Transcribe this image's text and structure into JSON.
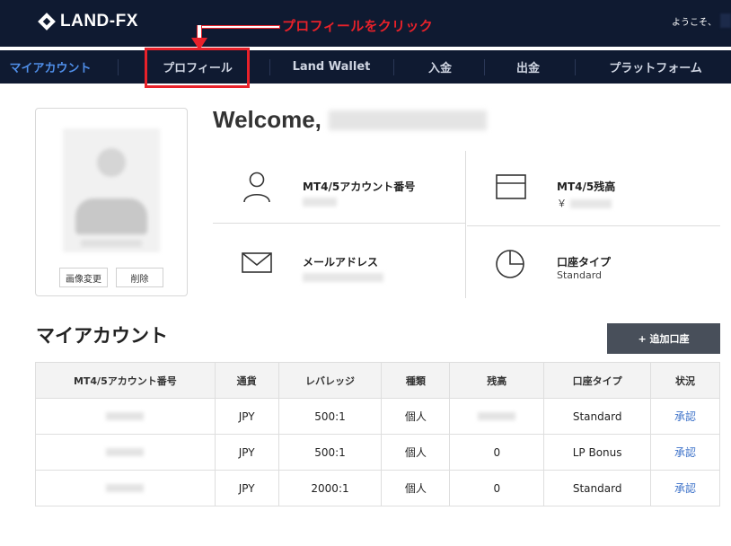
{
  "header": {
    "logo_text": "LAND-FX",
    "greeting": "ようこそ、"
  },
  "annotation": {
    "text": "プロフィールをクリック",
    "color": "#e8212a"
  },
  "nav": {
    "items": [
      {
        "label": "マイアカウント",
        "active": true
      },
      {
        "label": "プロフィール",
        "active": false
      },
      {
        "label": "Land Wallet",
        "active": false
      },
      {
        "label": "入金",
        "active": false
      },
      {
        "label": "出金",
        "active": false
      },
      {
        "label": "プラットフォーム",
        "active": false
      }
    ]
  },
  "profile_card": {
    "change_image_label": "画像変更",
    "delete_label": "削除"
  },
  "welcome": {
    "text": "Welcome,"
  },
  "info": {
    "account_number_label": "MT4/5アカウント番号",
    "balance_label": "MT4/5残高",
    "balance_currency": "￥",
    "email_label": "メールアドレス",
    "account_type_label": "口座タイプ",
    "account_type_value": "Standard"
  },
  "my_account": {
    "title": "マイアカウント",
    "add_button": "+ 追加口座",
    "columns": [
      "MT4/5アカウント番号",
      "通貨",
      "レバレッジ",
      "種類",
      "残高",
      "口座タイプ",
      "状況"
    ],
    "rows": [
      {
        "currency": "JPY",
        "leverage": "500:1",
        "kind": "個人",
        "balance": "",
        "type": "Standard",
        "status": "承認"
      },
      {
        "currency": "JPY",
        "leverage": "500:1",
        "kind": "個人",
        "balance": "0",
        "type": "LP Bonus",
        "status": "承認"
      },
      {
        "currency": "JPY",
        "leverage": "2000:1",
        "kind": "個人",
        "balance": "0",
        "type": "Standard",
        "status": "承認"
      }
    ]
  },
  "colors": {
    "header_bg": "#0f1a31",
    "active_nav": "#4f8ee8",
    "link": "#3d72c9",
    "add_button_bg": "#484f5a"
  }
}
